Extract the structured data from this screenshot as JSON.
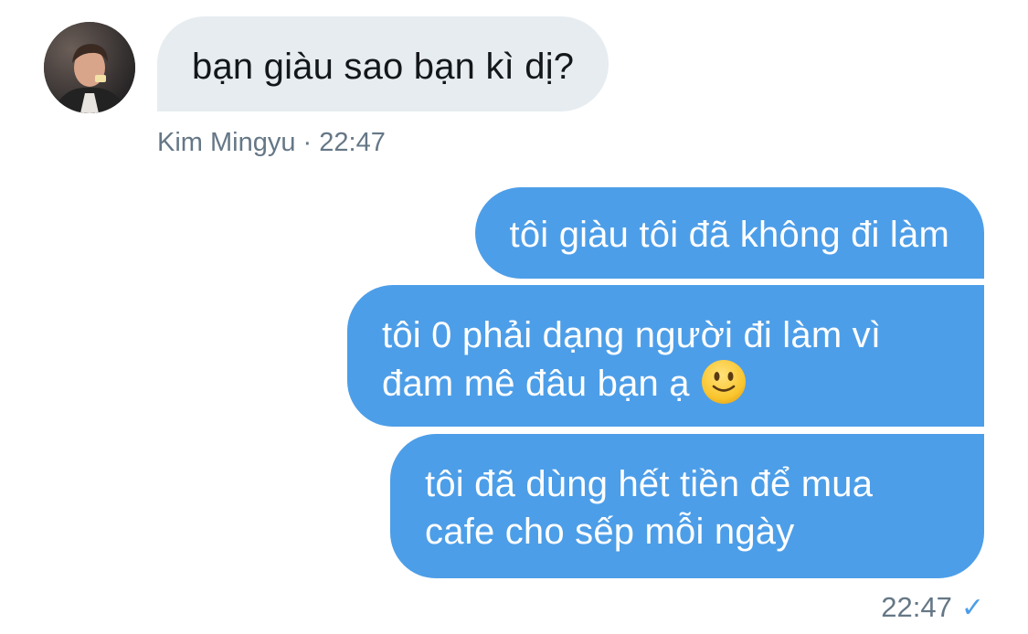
{
  "conversation": {
    "incoming": {
      "text": "bạn giàu sao bạn kì dị?",
      "sender": "Kim Mingyu",
      "separator": " · ",
      "time": "22:47"
    },
    "outgoing": [
      {
        "lines": [
          "tôi giàu tôi đã không đi làm"
        ]
      },
      {
        "lines": [
          "tôi 0 phải dạng người đi làm vì",
          "đam mê đâu bạn ạ"
        ],
        "emoji": "slightly-smiling-face-icon"
      },
      {
        "lines": [
          "tôi đã dùng hết tiền để mua",
          "cafe cho sếp mỗi ngày"
        ]
      }
    ],
    "read_time": "22:47",
    "read_icon": "checkmark-icon"
  },
  "colors": {
    "incoming_bubble": "#e6ecf0",
    "outgoing_bubble": "#4d9ee8",
    "meta_text": "#657786"
  }
}
